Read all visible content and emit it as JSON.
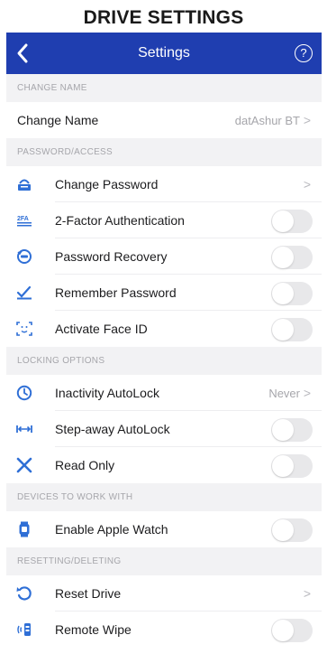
{
  "page_heading": "DRIVE SETTINGS",
  "navbar": {
    "title": "Settings",
    "help_label": "?"
  },
  "colors": {
    "nav": "#1f3eb0",
    "icon": "#2f6fd6",
    "section_bg": "#f2f2f4"
  },
  "sections": {
    "change_name": {
      "header": "CHANGE NAME",
      "change_name": {
        "label": "Change Name",
        "value": "datAshur BT",
        "chevron": ">"
      }
    },
    "password": {
      "header": "PASSWORD/ACCESS",
      "change_password": {
        "label": "Change Password",
        "chevron": ">",
        "icon": "key-card-icon"
      },
      "two_factor": {
        "label": "2-Factor Authentication",
        "icon": "2fa-icon",
        "toggle_on": false
      },
      "password_recovery": {
        "label": "Password Recovery",
        "icon": "recovery-icon",
        "toggle_on": false
      },
      "remember_password": {
        "label": "Remember Password",
        "icon": "remember-icon",
        "toggle_on": false
      },
      "face_id": {
        "label": "Activate Face ID",
        "icon": "face-id-icon",
        "toggle_on": false
      }
    },
    "locking": {
      "header": "LOCKING OPTIONS",
      "inactivity": {
        "label": "Inactivity AutoLock",
        "value": "Never",
        "chevron": ">",
        "icon": "clock-icon"
      },
      "step_away": {
        "label": "Step-away AutoLock",
        "icon": "distance-icon",
        "toggle_on": false
      },
      "read_only": {
        "label": "Read Only",
        "icon": "x-icon",
        "toggle_on": false
      }
    },
    "devices": {
      "header": "DEVICES TO WORK WITH",
      "apple_watch": {
        "label": "Enable Apple Watch",
        "icon": "watch-icon",
        "toggle_on": false
      }
    },
    "resetting": {
      "header": "RESETTING/DELETING",
      "reset_drive": {
        "label": "Reset Drive",
        "chevron": ">",
        "icon": "reset-icon"
      },
      "remote_wipe": {
        "label": "Remote Wipe",
        "icon": "remote-wipe-icon",
        "toggle_on": false
      }
    }
  }
}
